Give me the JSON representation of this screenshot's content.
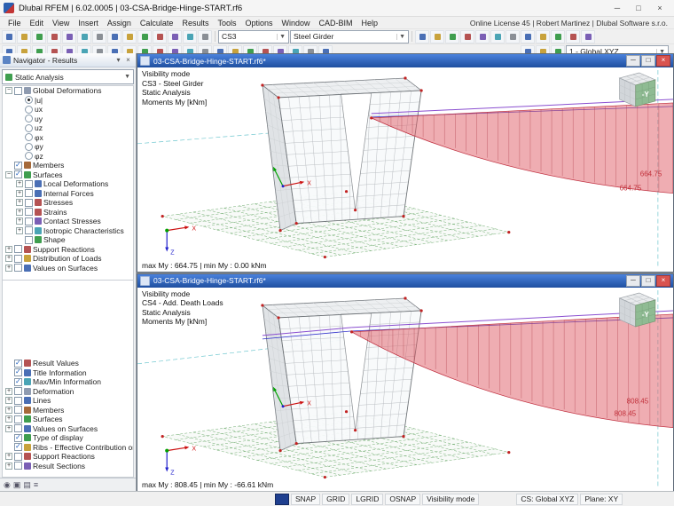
{
  "window": {
    "title": "Dlubal RFEM | 6.02.0005 | 03-CSA-Bridge-Hinge-START.rf6",
    "license": "Online License 45 | Robert Martinez | Dlubal Software s.r.o."
  },
  "menu": {
    "items": [
      "File",
      "Edit",
      "View",
      "Insert",
      "Assign",
      "Calculate",
      "Results",
      "Tools",
      "Options",
      "Window",
      "CAD-BIM",
      "Help"
    ]
  },
  "toolbars": {
    "row1_icons_a": [
      "new-icon",
      "open-icon",
      "save-icon",
      "print-icon",
      "page-setup-icon",
      "undo-icon",
      "redo-icon",
      "copy-icon",
      "paste-icon",
      "navigator-icon",
      "tables-icon",
      "calculate-all-icon",
      "loads-icon",
      "results-toggle-icon"
    ],
    "cs_combo": "CS3",
    "stage_combo": "Steel Girder",
    "row1_icons_b": [
      "graphics-printout-icon",
      "mass-print-icon",
      "clipboard-icon",
      "screenshot-icon",
      "find-icon",
      "zoom-icon",
      "settings-icon",
      "units-icon",
      "add-ons-icon",
      "scripts-icon",
      "configs-icon",
      "help-icon"
    ],
    "row2_icons": [
      "select-icon",
      "select-special-icon",
      "zoom-window-icon",
      "zoom-in-icon",
      "zoom-out-icon",
      "zoom-all-icon",
      "pan-icon",
      "orbit-icon",
      "previous-view-icon",
      "view-x-icon",
      "view-y-icon",
      "view-z-icon",
      "isometric-view-icon",
      "perspective-icon",
      "wireframe-icon",
      "shaded-icon",
      "transparent-icon",
      "hidden-lines-icon",
      "visibility-icon",
      "clipping-planes-icon",
      "work-plane-icon",
      "snap-settings-icon"
    ],
    "row2_icons_b": [
      "coordinate-system-icon",
      "grid-settings-icon",
      "plane-select-icon"
    ],
    "axes_combo": "1 - Global XYZ"
  },
  "navigator": {
    "title": "Navigator - Results",
    "analysis": "Static Analysis",
    "tree1": [
      {
        "label": "Global Deformations",
        "indent": 0,
        "ctrl": "check",
        "checked": false,
        "expand": "minus",
        "icon": "global-deformations-icon",
        "color": "#8f9bb0"
      },
      {
        "label": "|u|",
        "indent": 1,
        "ctrl": "radio",
        "checked": true
      },
      {
        "label": "ux",
        "indent": 1,
        "ctrl": "radio",
        "checked": false
      },
      {
        "label": "uy",
        "indent": 1,
        "ctrl": "radio",
        "checked": false
      },
      {
        "label": "uz",
        "indent": 1,
        "ctrl": "radio",
        "checked": false
      },
      {
        "label": "φx",
        "indent": 1,
        "ctrl": "radio",
        "checked": false
      },
      {
        "label": "φy",
        "indent": 1,
        "ctrl": "radio",
        "checked": false
      },
      {
        "label": "φz",
        "indent": 1,
        "ctrl": "radio",
        "checked": false
      },
      {
        "label": "Members",
        "indent": 0,
        "ctrl": "check",
        "checked": true,
        "icon": "members-icon",
        "color": "#a66a3a"
      },
      {
        "label": "Surfaces",
        "indent": 0,
        "ctrl": "check",
        "checked": true,
        "expand": "minus",
        "icon": "surfaces-icon",
        "color": "#3f9e4f"
      },
      {
        "label": "Local Deformations",
        "indent": 1,
        "ctrl": "check",
        "checked": false,
        "expand": "plus",
        "icon": "local-deformations-icon",
        "color": "#4a6fb5"
      },
      {
        "label": "Internal Forces",
        "indent": 1,
        "ctrl": "check",
        "checked": false,
        "expand": "plus",
        "icon": "internal-forces-icon",
        "color": "#4a6fb5"
      },
      {
        "label": "Stresses",
        "indent": 1,
        "ctrl": "check",
        "checked": false,
        "expand": "plus",
        "icon": "stresses-icon",
        "color": "#b55353"
      },
      {
        "label": "Strains",
        "indent": 1,
        "ctrl": "check",
        "checked": false,
        "expand": "plus",
        "icon": "strains-icon",
        "color": "#b55353"
      },
      {
        "label": "Contact Stresses",
        "indent": 1,
        "ctrl": "check",
        "checked": false,
        "expand": "plus",
        "icon": "contact-stresses-icon",
        "color": "#7a5fb5"
      },
      {
        "label": "Isotropic Characteristics",
        "indent": 1,
        "ctrl": "check",
        "checked": false,
        "expand": "plus",
        "icon": "isotropic-characteristics-icon",
        "color": "#4aa4b5"
      },
      {
        "label": "Shape",
        "indent": 1,
        "ctrl": "check",
        "checked": false,
        "icon": "shape-icon",
        "color": "#3f9e4f"
      },
      {
        "label": "Support Reactions",
        "indent": 0,
        "ctrl": "check",
        "checked": false,
        "expand": "plus",
        "icon": "support-reactions-icon",
        "color": "#b55353"
      },
      {
        "label": "Distribution of Loads",
        "indent": 0,
        "ctrl": "check",
        "checked": false,
        "expand": "plus",
        "icon": "distribution-of-loads-icon",
        "color": "#c8a23c"
      },
      {
        "label": "Values on Surfaces",
        "indent": 0,
        "ctrl": "check",
        "checked": false,
        "expand": "plus",
        "icon": "values-on-surfaces-icon",
        "color": "#4a6fb5"
      }
    ],
    "tree2": [
      {
        "label": "Result Values",
        "indent": 0,
        "ctrl": "check",
        "checked": true,
        "icon": "result-values-icon",
        "color": "#b55353"
      },
      {
        "label": "Title Information",
        "indent": 0,
        "ctrl": "check",
        "checked": true,
        "icon": "title-information-icon",
        "color": "#4a6fb5"
      },
      {
        "label": "Max/Min Information",
        "indent": 0,
        "ctrl": "check",
        "checked": true,
        "icon": "maxmin-information-icon",
        "color": "#4aa4b5"
      },
      {
        "label": "Deformation",
        "indent": 0,
        "ctrl": "check",
        "checked": false,
        "expand": "plus",
        "icon": "deformation-icon",
        "color": "#8f9bb0"
      },
      {
        "label": "Lines",
        "indent": 0,
        "ctrl": "check",
        "checked": false,
        "expand": "plus",
        "icon": "lines-icon",
        "color": "#4a6fb5"
      },
      {
        "label": "Members",
        "indent": 0,
        "ctrl": "check",
        "checked": false,
        "expand": "plus",
        "icon": "members2-icon",
        "color": "#a66a3a"
      },
      {
        "label": "Surfaces",
        "indent": 0,
        "ctrl": "check",
        "checked": false,
        "expand": "plus",
        "icon": "surfaces2-icon",
        "color": "#3f9e4f"
      },
      {
        "label": "Values on Surfaces",
        "indent": 0,
        "ctrl": "check",
        "checked": false,
        "expand": "plus",
        "icon": "values-on-surfaces2-icon",
        "color": "#4a6fb5"
      },
      {
        "label": "Type of display",
        "indent": 0,
        "ctrl": "check",
        "checked": true,
        "icon": "type-of-display-icon",
        "color": "#3f9e4f"
      },
      {
        "label": "Ribs - Effective Contribution on Surface...",
        "indent": 0,
        "ctrl": "check",
        "checked": true,
        "icon": "ribs-icon",
        "color": "#c8a23c"
      },
      {
        "label": "Support Reactions",
        "indent": 0,
        "ctrl": "check",
        "checked": false,
        "expand": "plus",
        "icon": "support-reactions2-icon",
        "color": "#b55353"
      },
      {
        "label": "Result Sections",
        "indent": 0,
        "ctrl": "check",
        "checked": false,
        "expand": "plus",
        "icon": "result-sections-icon",
        "color": "#7a5fb5"
      }
    ],
    "bottom_icons": [
      "show-results-icon",
      "snapshot-icon",
      "display-mode-icon",
      "panel-options-icon"
    ]
  },
  "viewports": [
    {
      "title": "03-CSA-Bridge-Hinge-START.rf6*",
      "info": [
        "Visibility mode",
        "CS3 - Steel Girder",
        "Static Analysis",
        "Moments My [kNm]"
      ],
      "result_line": "max My : 664.75 | min My : 0.00 kNm",
      "value_label": "664.75"
    },
    {
      "title": "03-CSA-Bridge-Hinge-START.rf6*",
      "info": [
        "Visibility mode",
        "CS4 - Add. Death Loads",
        "Static Analysis",
        "Moments My [kNm]"
      ],
      "result_line": "max My : 808.45 | min My : -66.61 kNm",
      "value_label": "808.45"
    }
  ],
  "scene": {
    "axis_x": "X",
    "axis_z": "Z",
    "cube_label": "-Y",
    "moment_fill": "#df5c66",
    "deck_line_top": "#8a4fd0",
    "deck_line_bottom": "#3333cc",
    "grid_color": "#5aa05a",
    "value_color": "#c2303a"
  },
  "statusbar": {
    "toggles": [
      "SNAP",
      "GRID",
      "LGRID",
      "OSNAP",
      "Visibility mode"
    ],
    "cs": "CS: Global XYZ",
    "plane": "Plane: XY"
  }
}
